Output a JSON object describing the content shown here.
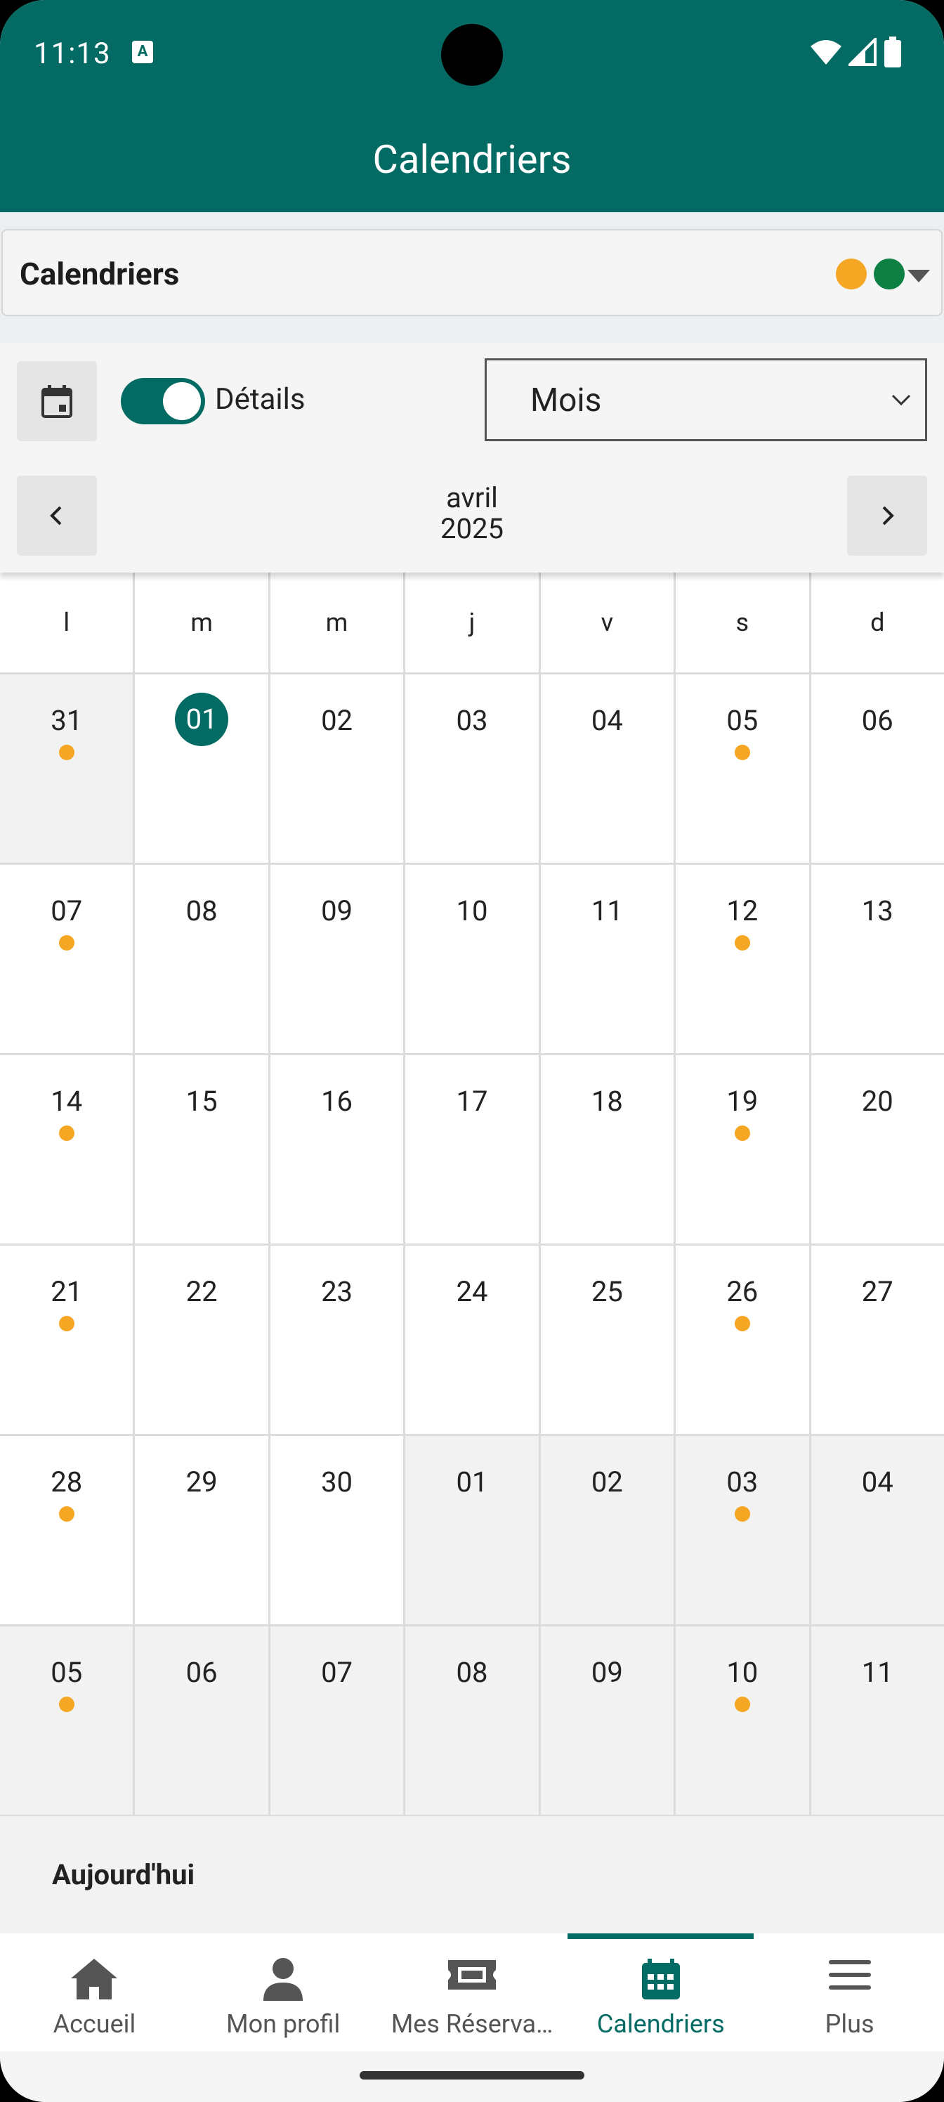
{
  "status_bar": {
    "time": "11:13",
    "notification_icon": "A"
  },
  "app_bar": {
    "title": "Calendriers"
  },
  "calendar_selector": {
    "title": "Calendriers",
    "calendar_colors": [
      "#F5A623",
      "#0E8043"
    ]
  },
  "controls": {
    "details_label": "Détails",
    "details_on": true,
    "view_select": {
      "value": "Mois"
    }
  },
  "month_nav": {
    "month": "avril",
    "year": "2025"
  },
  "weekdays": [
    "l",
    "m",
    "m",
    "j",
    "v",
    "s",
    "d"
  ],
  "weeks": [
    [
      {
        "n": "31",
        "other": true,
        "dot": true
      },
      {
        "n": "01",
        "today": true
      },
      {
        "n": "02"
      },
      {
        "n": "03"
      },
      {
        "n": "04"
      },
      {
        "n": "05",
        "dot": true
      },
      {
        "n": "06"
      }
    ],
    [
      {
        "n": "07",
        "dot": true
      },
      {
        "n": "08"
      },
      {
        "n": "09"
      },
      {
        "n": "10"
      },
      {
        "n": "11"
      },
      {
        "n": "12",
        "dot": true
      },
      {
        "n": "13"
      }
    ],
    [
      {
        "n": "14",
        "dot": true
      },
      {
        "n": "15"
      },
      {
        "n": "16"
      },
      {
        "n": "17"
      },
      {
        "n": "18"
      },
      {
        "n": "19",
        "dot": true
      },
      {
        "n": "20"
      }
    ],
    [
      {
        "n": "21",
        "dot": true
      },
      {
        "n": "22"
      },
      {
        "n": "23"
      },
      {
        "n": "24"
      },
      {
        "n": "25"
      },
      {
        "n": "26",
        "dot": true
      },
      {
        "n": "27"
      }
    ],
    [
      {
        "n": "28",
        "dot": true
      },
      {
        "n": "29"
      },
      {
        "n": "30"
      },
      {
        "n": "01",
        "other": true
      },
      {
        "n": "02",
        "other": true
      },
      {
        "n": "03",
        "other": true,
        "dot": true
      },
      {
        "n": "04",
        "other": true
      }
    ],
    [
      {
        "n": "05",
        "other": true,
        "dot": true
      },
      {
        "n": "06",
        "other": true
      },
      {
        "n": "07",
        "other": true
      },
      {
        "n": "08",
        "other": true
      },
      {
        "n": "09",
        "other": true
      },
      {
        "n": "10",
        "other": true,
        "dot": true
      },
      {
        "n": "11",
        "other": true
      }
    ]
  ],
  "today_section": {
    "label": "Aujourd'hui"
  },
  "bottom_nav": [
    {
      "label": "Accueil",
      "icon": "home-icon"
    },
    {
      "label": "Mon profil",
      "icon": "person-icon"
    },
    {
      "label": "Mes Réserva…",
      "icon": "ticket-icon"
    },
    {
      "label": "Calendriers",
      "icon": "calendar-icon",
      "active": true
    },
    {
      "label": "Plus",
      "icon": "menu-icon"
    }
  ],
  "colors": {
    "primary": "#036B63",
    "event_dot": "#F5A623",
    "calendar_green": "#0E8043"
  }
}
